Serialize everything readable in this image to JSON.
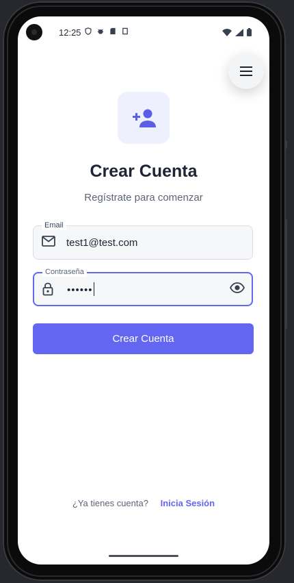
{
  "status_bar": {
    "time": "12:25",
    "left_icons": [
      "vpn-shield-icon",
      "bug-icon",
      "sd-card-icon",
      "screen-icon"
    ],
    "right_icons": [
      "wifi-icon",
      "signal-icon",
      "battery-icon"
    ]
  },
  "menu": {
    "icon": "hamburger-menu-icon"
  },
  "hero": {
    "icon": "person-add-icon"
  },
  "header": {
    "title": "Crear Cuenta",
    "subtitle": "Regístrate para comenzar"
  },
  "form": {
    "email": {
      "label": "Email",
      "value": "test1@test.com",
      "icon": "mail-icon"
    },
    "password": {
      "label": "Contraseña",
      "value": "••••••",
      "icon": "lock-icon",
      "toggle_icon": "eye-icon"
    },
    "submit_label": "Crear Cuenta"
  },
  "footer": {
    "prompt": "¿Ya tienes cuenta?",
    "link": "Inicia Sesión"
  },
  "colors": {
    "accent": "#6366f1",
    "accent_light": "#eef0fd",
    "title": "#1f2333",
    "muted": "#5b6476"
  }
}
